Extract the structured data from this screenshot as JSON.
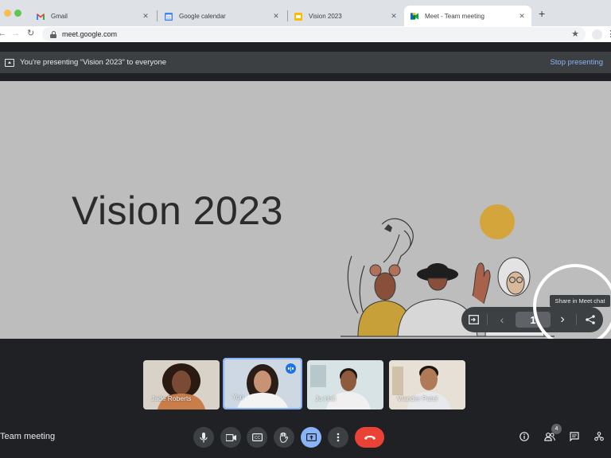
{
  "browser": {
    "tabs": [
      {
        "title": "Gmail",
        "icon": "gmail-icon"
      },
      {
        "title": "Google calendar",
        "icon": "calendar-icon"
      },
      {
        "title": "Vision 2023",
        "icon": "slides-icon"
      },
      {
        "title": "Meet - Team meeting",
        "icon": "meet-icon",
        "active": true
      }
    ],
    "close_glyph": "✕",
    "new_tab_glyph": "+",
    "url": "meet.google.com"
  },
  "banner": {
    "text": "You're presenting “Vision 2023” to everyone",
    "stop_label": "Stop presenting"
  },
  "slide": {
    "title": "Vision 2023",
    "current_page": "1",
    "tooltip": "Share in Meet chat"
  },
  "participants": [
    {
      "name": "Jade Roberts",
      "skin": "#7a4a34",
      "bg": "#d9d2c8",
      "hair": "#2b1a12",
      "shirt": "#c87d4a"
    },
    {
      "name": "You",
      "skin": "#c89274",
      "bg": "#cdd8e3",
      "hair": "#2a1d17",
      "shirt": "#f3f3f3",
      "speaking": true
    },
    {
      "name": "Jo Hall",
      "skin": "#8f5b3e",
      "bg": "#d8e3e6",
      "hair": "#1f1612",
      "shirt": "#f0f0f0"
    },
    {
      "name": "Vlander Patel",
      "skin": "#b07a58",
      "bg": "#e6e0d6",
      "hair": "#1c1612",
      "shirt": "#e7e9ec"
    }
  ],
  "meeting": {
    "name": "Team meeting",
    "people_count": "4"
  },
  "colors": {
    "accent": "#8ab4f8",
    "end_call": "#ea4335",
    "slide_bg": "#bdbdbd"
  }
}
